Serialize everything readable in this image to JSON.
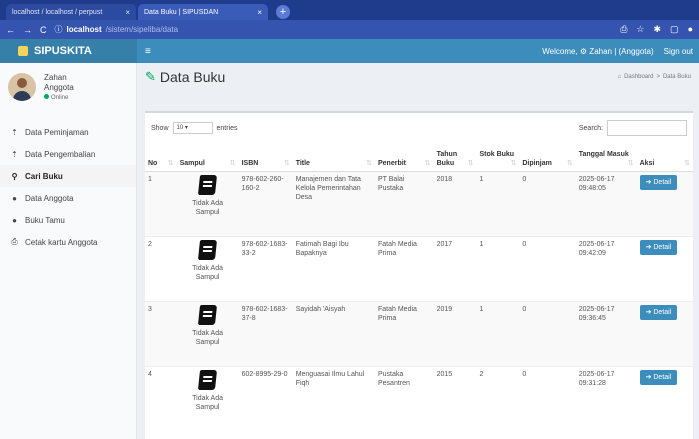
{
  "browser": {
    "tabs": [
      {
        "label": "localhost / localhost / perpust"
      },
      {
        "label": "Data Buku | SIPUSDAN"
      }
    ],
    "new_tab": "+",
    "url_host": "localhost",
    "url_path": "/sistem/sipeliba/data"
  },
  "topbar": {
    "brand": "SIPUSKITA",
    "menu_toggle": "≡",
    "welcome": "Welcome, ⚙ Zahan | (Anggota)",
    "signout": "Sign out"
  },
  "user": {
    "name": "Zahan",
    "role": "Anggota",
    "status": "Online"
  },
  "sidebar": {
    "items": [
      {
        "label": "Data Peminjaman",
        "icon": "upload-icon"
      },
      {
        "label": "Data Pengembalian",
        "icon": "upload-icon"
      },
      {
        "label": "Cari Buku",
        "icon": "search-icon",
        "active": true
      },
      {
        "label": "Data Anggota",
        "icon": "user-icon"
      },
      {
        "label": "Buku Tamu",
        "icon": "user-icon"
      },
      {
        "label": "Cetak kartu Anggota",
        "icon": "print-icon"
      }
    ]
  },
  "page": {
    "title": "Data Buku",
    "breadcrumb": [
      "Dashboard",
      ">",
      "Data Buku"
    ]
  },
  "table_controls": {
    "show": "Show",
    "entries_value": "10",
    "entries": "entries",
    "search": "Search:"
  },
  "table": {
    "headers": [
      "No",
      "Sampul",
      "ISBN",
      "Title",
      "Penerbit",
      "Tahun Buku",
      "Stok Buku",
      "Dipinjam",
      "Tanggal Masuk",
      "Aksi"
    ],
    "rows": [
      {
        "no": "1",
        "sampul": "Tidak Ada Sampul",
        "isbn": "978-602-260-160-2",
        "title": "Manajemen dan Tata Kelola Pemerintahan Desa",
        "penerbit": "PT Balai Pustaka",
        "tahun": "2018",
        "stok": "1",
        "dipinjam": "0",
        "tanggal": "2025-06-17 09:48:05",
        "aksi": "Detail"
      },
      {
        "no": "2",
        "sampul": "Tidak Ada Sampul",
        "isbn": "978-602-1683-33-2",
        "title": "Fatimah Bagi Ibu Bapaknya",
        "penerbit": "Fatah Media Prima",
        "tahun": "2017",
        "stok": "1",
        "dipinjam": "0",
        "tanggal": "2025-06-17 09:42:09",
        "aksi": "Detail"
      },
      {
        "no": "3",
        "sampul": "Tidak Ada Sampul",
        "isbn": "978-602-1683-37-8",
        "title": "Sayidah 'Aisyah",
        "penerbit": "Fatah Media Prima",
        "tahun": "2019",
        "stok": "1",
        "dipinjam": "0",
        "tanggal": "2025-06-17 09:36:45",
        "aksi": "Detail"
      },
      {
        "no": "4",
        "sampul": "Tidak Ada Sampul",
        "isbn": "602-8995-29-0",
        "title": "Menguasai Ilmu Lahul Fiqh",
        "penerbit": "Pustaka Pesantren",
        "tahun": "2015",
        "stok": "2",
        "dipinjam": "0",
        "tanggal": "2025-06-17 09:31:28",
        "aksi": "Detail"
      }
    ]
  }
}
